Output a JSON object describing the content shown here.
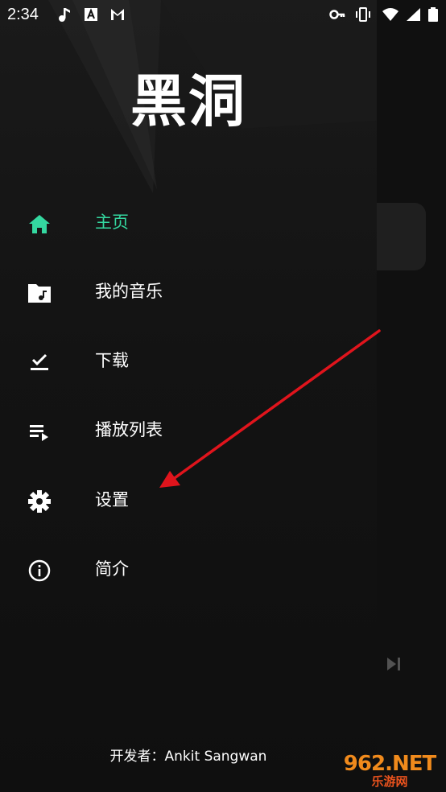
{
  "status_bar": {
    "time": "2:34",
    "left_icons": [
      "music-note-icon",
      "a-notification-icon",
      "gmail-icon"
    ],
    "right_icons": [
      "key-icon",
      "vibrate-icon",
      "wifi-icon",
      "signal-icon",
      "battery-icon"
    ]
  },
  "drawer": {
    "title": "黑洞",
    "items": [
      {
        "label": "主页",
        "icon": "home-icon",
        "active": true
      },
      {
        "label": "我的音乐",
        "icon": "music-folder-icon",
        "active": false
      },
      {
        "label": "下载",
        "icon": "download-check-icon",
        "active": false
      },
      {
        "label": "播放列表",
        "icon": "playlist-icon",
        "active": false
      },
      {
        "label": "设置",
        "icon": "gear-icon",
        "active": false
      },
      {
        "label": "简介",
        "icon": "info-icon",
        "active": false
      }
    ],
    "footer": "开发者：Ankit Sangwan"
  },
  "watermark": {
    "text": "962.NET",
    "sub": "乐游网"
  },
  "colors": {
    "accent": "#34d8a0",
    "background": "#0b0b0b",
    "arrow": "#e0141c"
  }
}
